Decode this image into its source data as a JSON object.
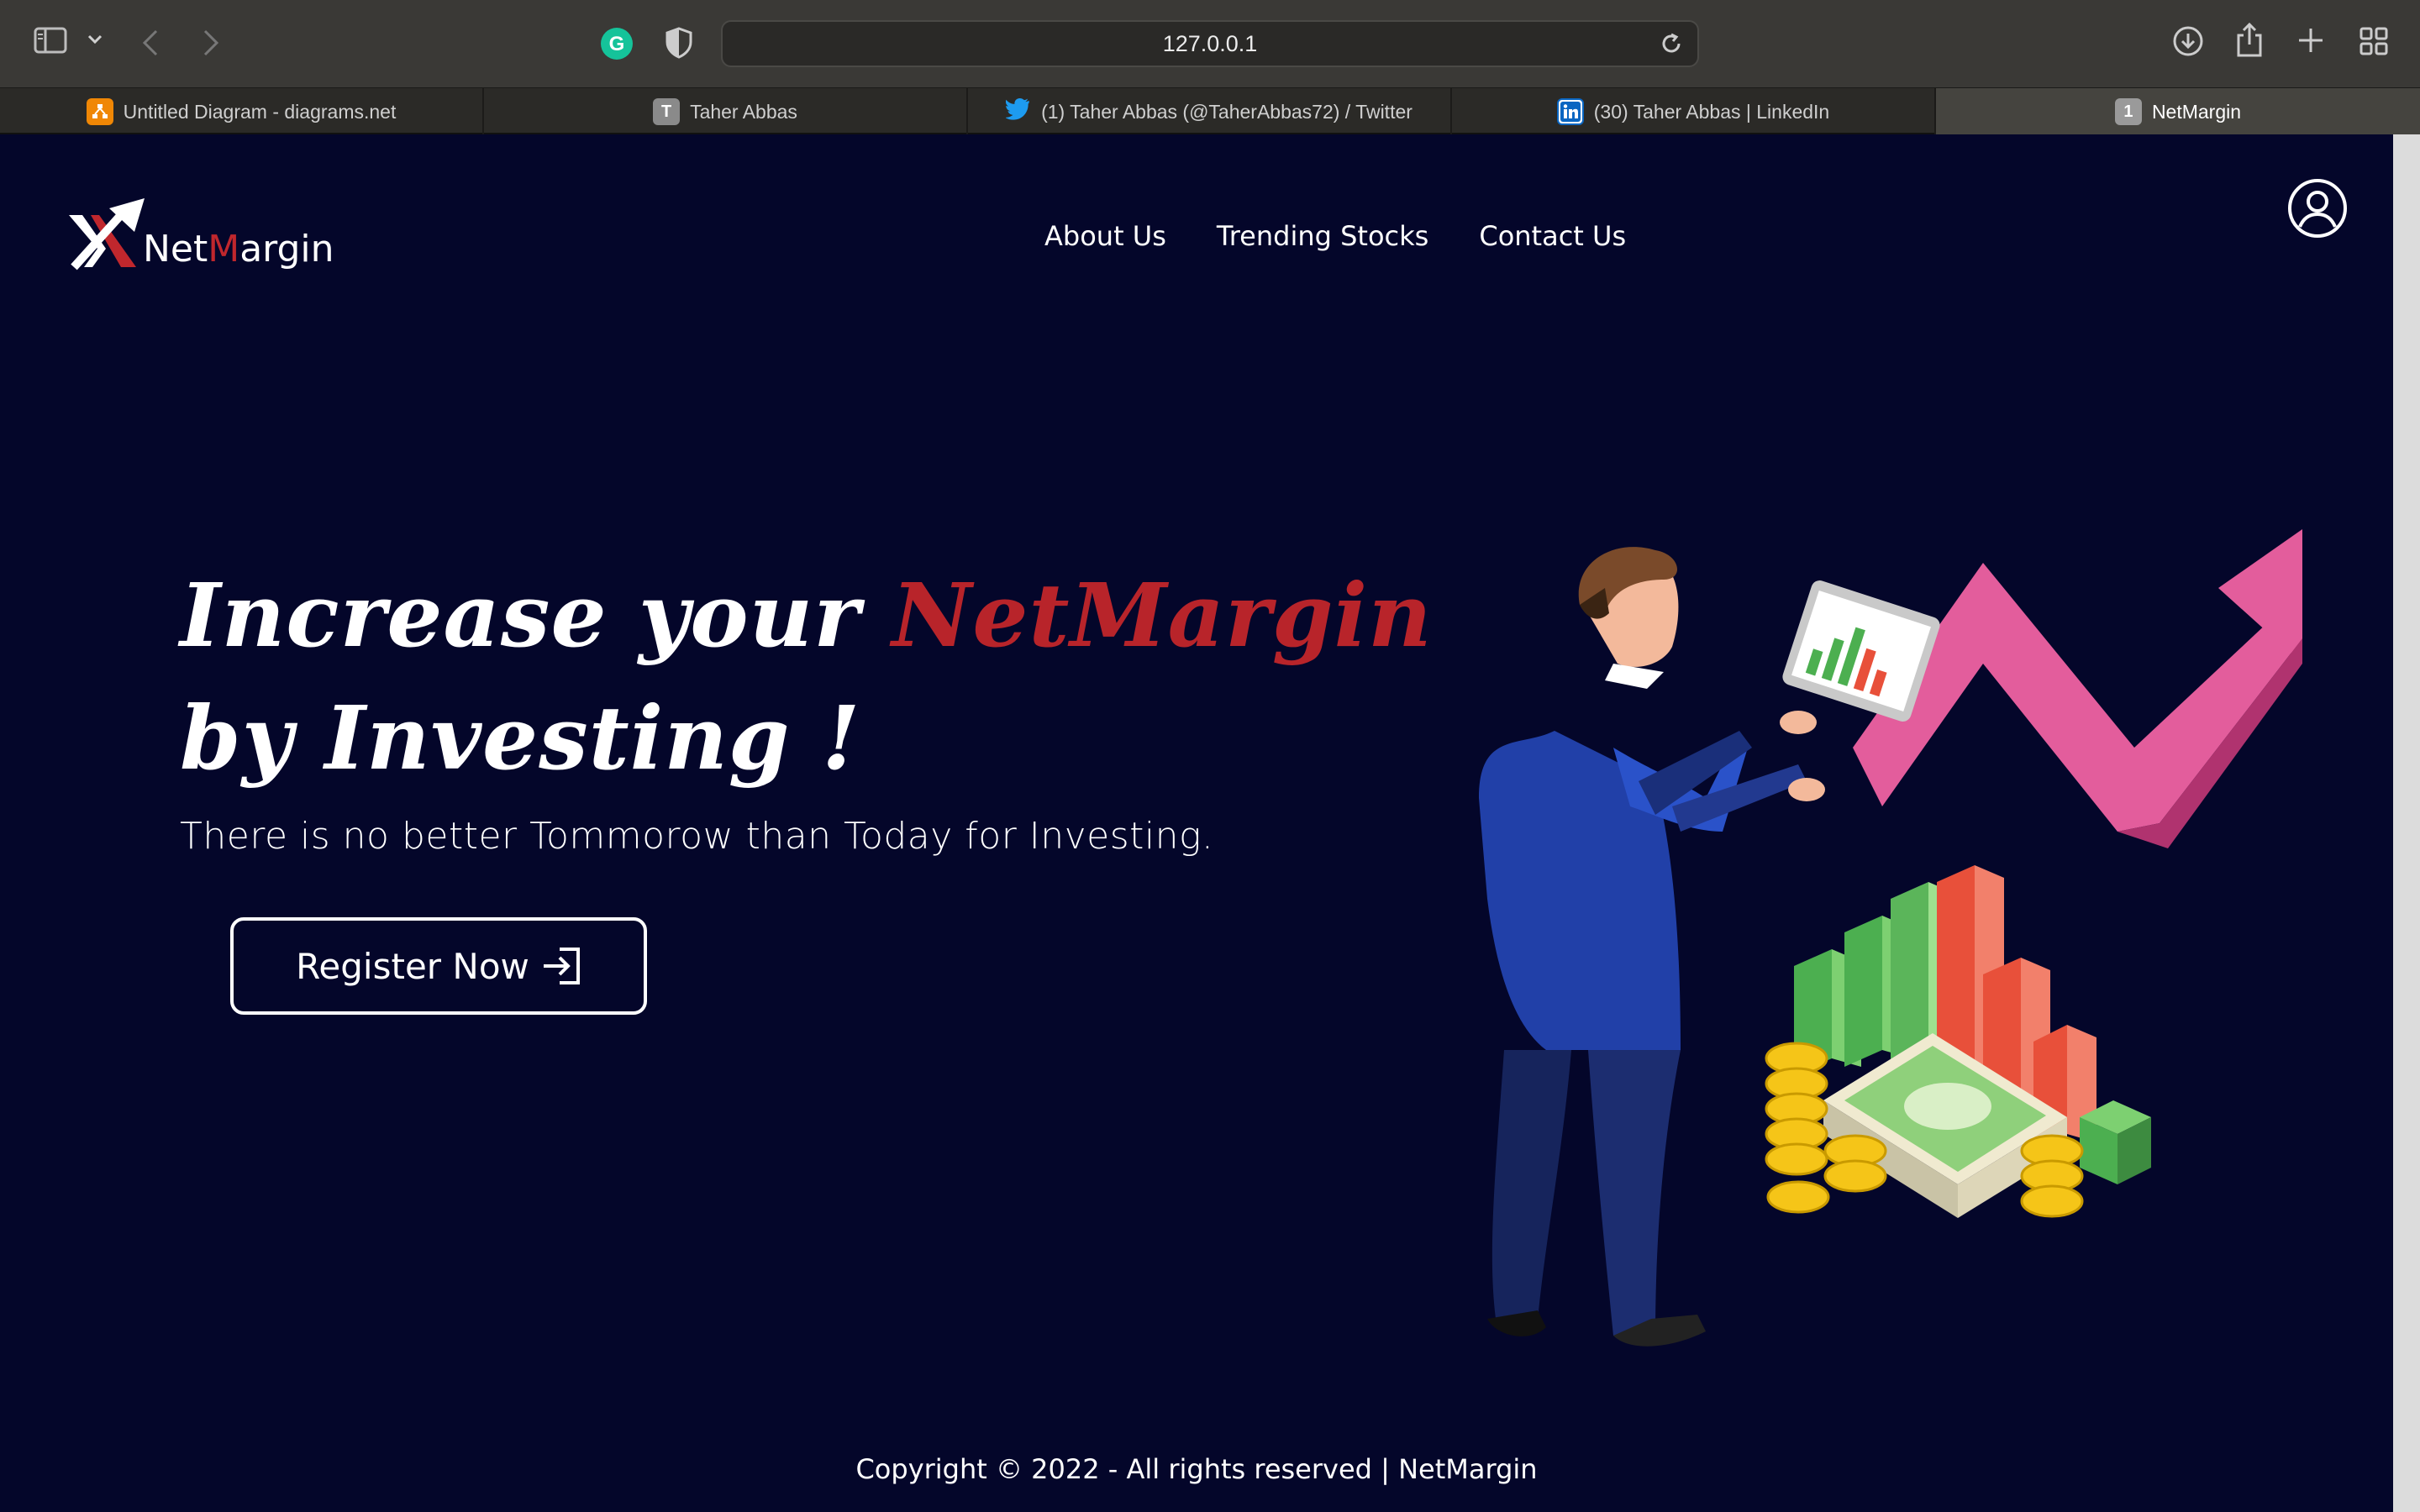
{
  "browser": {
    "url": "127.0.0.1",
    "tabs": [
      {
        "title": "Untitled Diagram - diagrams.net",
        "favicon": "diagrams-icon"
      },
      {
        "title": "Taher Abbas",
        "favicon": "T"
      },
      {
        "title": "(1) Taher Abbas (@TaherAbbas72) / Twitter",
        "favicon": "twitter-icon"
      },
      {
        "title": "(30) Taher Abbas | LinkedIn",
        "favicon": "linkedin-icon"
      },
      {
        "title": "NetMargin",
        "favicon": "1"
      }
    ],
    "active_tab": 4
  },
  "site": {
    "logo_net": "Net",
    "logo_m": "M",
    "logo_rest": "argin",
    "nav": [
      "About Us",
      "Trending Stocks",
      "Contact Us"
    ]
  },
  "hero": {
    "title_part1": "Increase your ",
    "title_brand": "NetMargin",
    "title_part2": " by Investing !",
    "subtitle": "There is no better Tommorow than Today for Investing.",
    "cta_label": "Register Now"
  },
  "footer": {
    "copyright": "Copyright © 2022 - All rights reserved | NetMargin"
  },
  "colors": {
    "background": "#04062a",
    "brand_red": "#b8242a",
    "text": "#ffffff"
  }
}
